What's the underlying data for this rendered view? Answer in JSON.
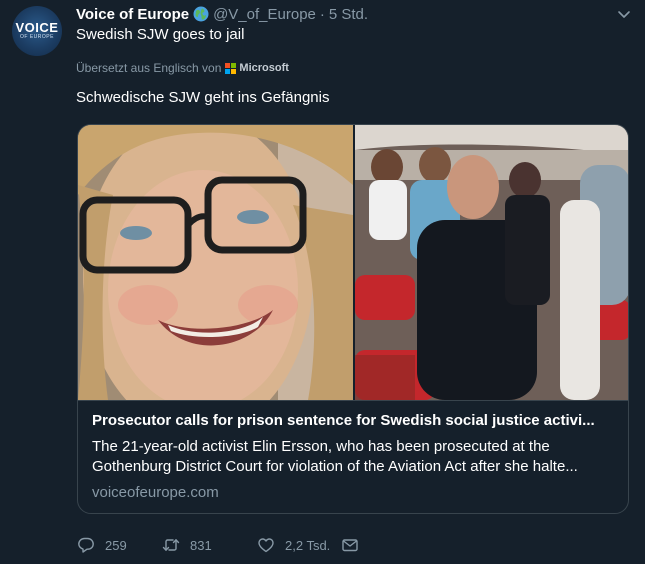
{
  "tweet": {
    "author_name": "Voice of Europe",
    "handle": "@V_of_Europe",
    "separator": "·",
    "time": "5 Std.",
    "text": "Swedish SJW goes to jail",
    "translated_label": "Übersetzt aus Englisch von",
    "translator": "Microsoft",
    "translation": "Schwedische SJW geht ins Gefängnis",
    "avatar": {
      "main": "VOICE",
      "sub": "OF EUROPE"
    }
  },
  "card": {
    "title": "Prosecutor calls for prison sentence for Swedish social justice activi...",
    "description_line1": "The 21-year-old activist Elin Ersson, who has been prosecuted at the",
    "description_line2": "Gothenburg District Court for violation of the Aviation Act after she halte...",
    "domain": "voiceofeurope.com"
  },
  "actions": {
    "replies": "259",
    "retweets": "831",
    "likes": "2,2 Tsd."
  },
  "colors": {
    "background": "#15202b",
    "secondary_text": "#8899a6",
    "border": "#38444d"
  }
}
